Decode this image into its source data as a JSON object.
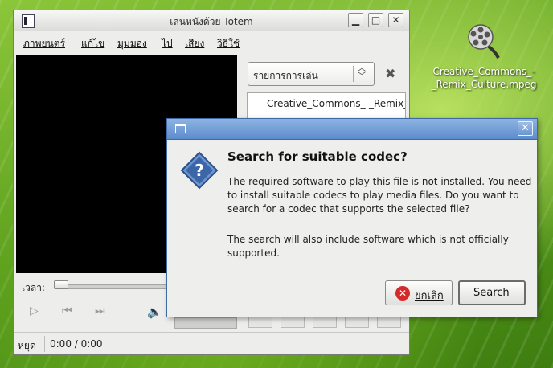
{
  "totem": {
    "title": "เล่นหนังด้วย  Totem",
    "menu": [
      "ภาพยนตร์",
      "แก้ไข",
      "มุมมอง",
      "ไป",
      "เสียง",
      "วิธีใช้"
    ],
    "playlist_select": "รายการการเล่น",
    "playlist_item": "Creative_Commons_-_Remix_Culture.mpeg",
    "time_label": "เวลา:",
    "status_text": "หยุด",
    "status_time": "0:00 / 0:00"
  },
  "desktop": {
    "icon_label": "Creative_Commons_-_Remix_Culture.mpeg"
  },
  "dialog": {
    "heading": "Search for suitable codec?",
    "message1": "The required software to play this file is not installed. You need to install suitable codecs to play media files. Do you want to search for a codec that supports the selected file?",
    "message2": "The search will also include software which is not officially supported.",
    "cancel_label": "ยกเลิก",
    "search_label": "Search"
  },
  "colors": {
    "dialog_title": "#5d8ccc",
    "desktop_bg": "#6fb020"
  },
  "icons": [
    "totem-app-icon",
    "minimize-icon",
    "maximize-icon",
    "close-icon",
    "playlist-close-icon",
    "play-icon",
    "previous-icon",
    "next-icon",
    "volume-icon",
    "film-reel-icon",
    "question-icon",
    "cancel-icon"
  ]
}
